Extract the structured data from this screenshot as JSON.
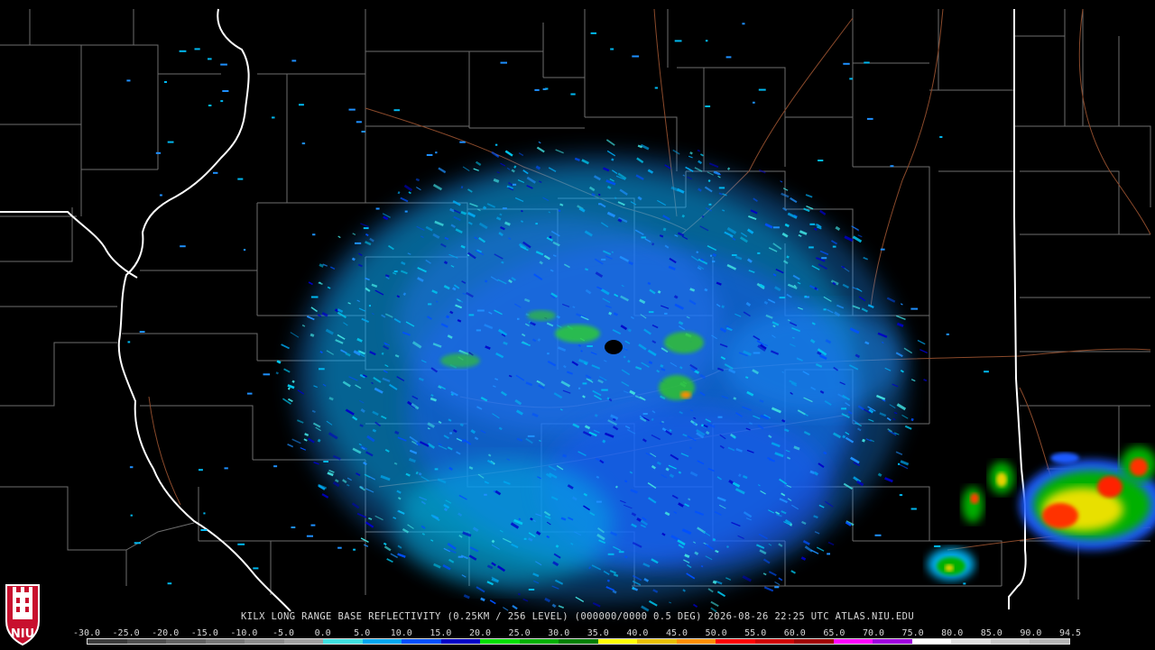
{
  "product": {
    "caption": "KILX LONG RANGE BASE REFLECTIVITY (0.25KM / 256 LEVEL) (000000/0000 0.5 DEG) 2026-08-26 22:25 UTC  ATLAS.NIU.EDU"
  },
  "scale": {
    "labels": [
      "-30.0",
      "-25.0",
      "-20.0",
      "-15.0",
      "-10.0",
      "-5.0",
      "0.0",
      "5.0",
      "10.0",
      "15.0",
      "20.0",
      "25.0",
      "30.0",
      "35.0",
      "40.0",
      "45.0",
      "50.0",
      "55.0",
      "60.0",
      "65.0",
      "70.0",
      "75.0",
      "80.0",
      "85.0",
      "90.0",
      "94.5"
    ],
    "colors": [
      "#3c3c3c",
      "#505050",
      "#646464",
      "#787878",
      "#8c8c8c",
      "#a0a0a0",
      "#40e0e0",
      "#00a8f0",
      "#0050ff",
      "#0000c8",
      "#00e000",
      "#00b000",
      "#008000",
      "#ffff00",
      "#e8c000",
      "#ff9000",
      "#ff0000",
      "#d00000",
      "#a00000",
      "#ff00ff",
      "#a000e0",
      "#ffffff",
      "#e0e0e0",
      "#c8c8c8",
      "#b4b4b4"
    ]
  },
  "logo": {
    "text": "NIU"
  },
  "colors": {
    "background": "#000000",
    "county_lines": "#6e6e6e",
    "state_lines": "#ffffff",
    "highways": "#8b4a2b"
  }
}
